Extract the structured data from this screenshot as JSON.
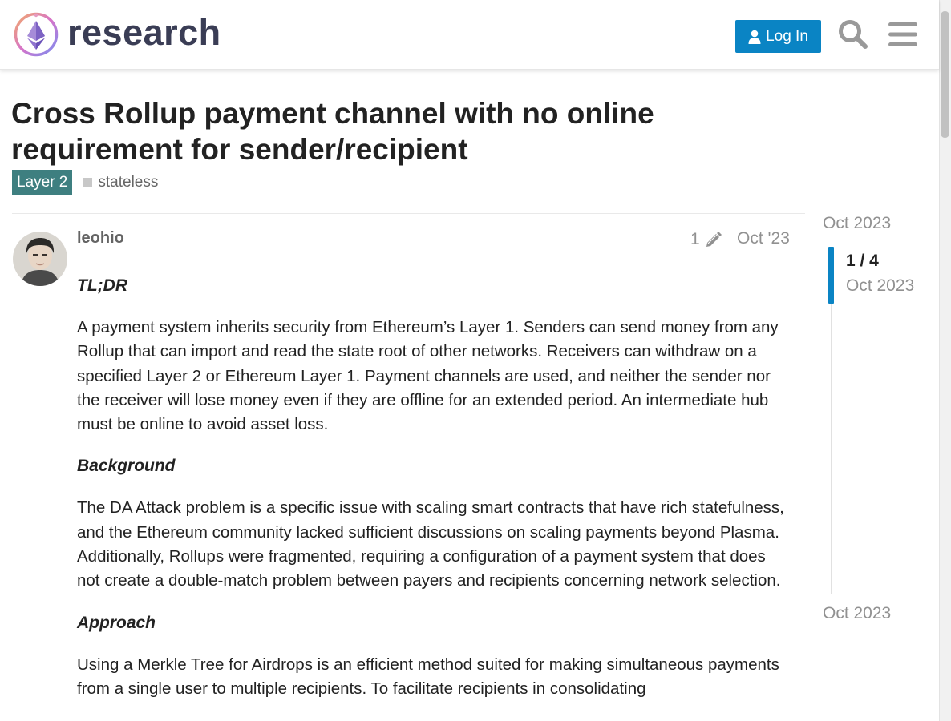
{
  "header": {
    "logo_text": "research",
    "login_label": "Log In",
    "search_icon": "search-icon",
    "menu_icon": "hamburger-menu-icon"
  },
  "topic": {
    "title": "Cross Rollup payment channel with no online requirement for sender/recipient",
    "category": "Layer 2",
    "category_color": "#3e7f80",
    "tags": [
      "stateless"
    ]
  },
  "post": {
    "author": "leohio",
    "edit_count": "1",
    "edit_icon": "pencil-icon",
    "date": "Oct '23",
    "sections": [
      {
        "heading": "TL;DR",
        "text": "A payment system inherits security from Ethereum’s Layer 1. Senders can send money from any Rollup that can import and read the state root of other networks. Receivers can withdraw on a specified Layer 2 or Ethereum Layer 1. Payment channels are used, and neither the sender nor the receiver will lose money even if they are offline for an extended period. An intermediate hub must be online to avoid asset loss."
      },
      {
        "heading": "Background",
        "text": "The DA Attack problem is a specific issue with scaling smart contracts that have rich statefulness, and the Ethereum community lacked sufficient discussions on scaling payments beyond Plasma. Additionally, Rollups were fragmented, requiring a configuration of a payment system that does not create a double-match problem between payers and recipients concerning network selection."
      },
      {
        "heading": "Approach",
        "text": "Using a Merkle Tree for Airdrops is an efficient method suited for making simultaneous payments from a single user to multiple recipients. To facilitate recipients in consolidating"
      }
    ]
  },
  "timeline": {
    "start_date": "Oct 2023",
    "position": "1 / 4",
    "position_date": "Oct 2023",
    "end_date": "Oct 2023"
  },
  "colors": {
    "accent": "#0a84c4",
    "muted_text": "#919191"
  }
}
